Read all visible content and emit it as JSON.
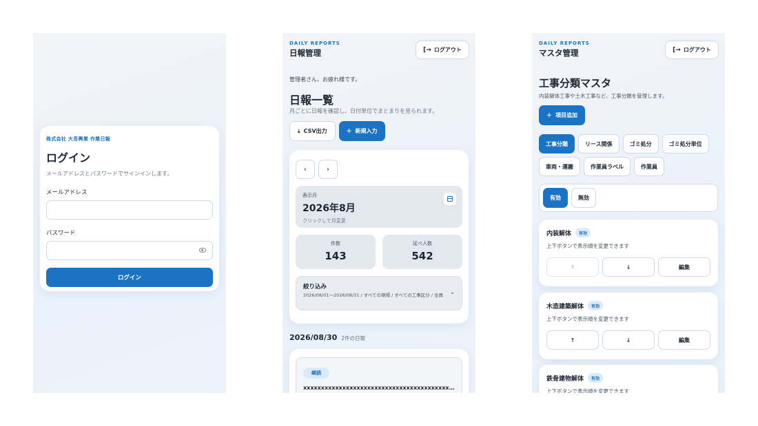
{
  "login": {
    "brand": "株式会社 大吾興業 作業日報",
    "title": "ログイン",
    "subtitle": "メールアドレスとパスワードでサインインします。",
    "email_label": "メールアドレス",
    "email_value": "",
    "password_label": "パスワード",
    "password_value": "",
    "submit_label": "ログイン"
  },
  "reports": {
    "kicker": "DAILY REPORTS",
    "title": "日報管理",
    "logout_label": "ログアウト",
    "greeting": "管理者さん、お疲れ様です。",
    "page_title": "日報一覧",
    "page_subtitle": "月ごとに日報を確認し、日付単位でまとまりを見られます。",
    "csv_label": "CSV出力",
    "new_label": "新規入力",
    "prev_label": "‹",
    "next_label": "›",
    "month_label": "表示月",
    "month_value": "2026年8月",
    "month_hint": "クリックして月変更",
    "stats": [
      {
        "label": "件数",
        "value": "143"
      },
      {
        "label": "延べ人数",
        "value": "542"
      }
    ],
    "filter_title": "絞り込み",
    "filter_desc": "2026/08/01〜2026/08/31 / すべての現場 / すべての工事区分 / 全員",
    "date_heading": "2026/08/30",
    "date_count": "2件の日報",
    "entry_status": "継続",
    "entry_text": "xxxxxxxxxxxxxxxxxxxxxxxxxxxxxxxxxxxxxxxxxxxxxxxx"
  },
  "master": {
    "kicker": "DAILY REPORTS",
    "title": "マスタ管理",
    "logout_label": "ログアウト",
    "page_title": "工事分類マスタ",
    "page_subtitle": "内装解体工事や土木工事など、工事分類を管理します。",
    "add_label": "項目追加",
    "tabs": [
      {
        "label": "工事分類",
        "active": true
      },
      {
        "label": "リース関係",
        "active": false
      },
      {
        "label": "ゴミ処分",
        "active": false
      },
      {
        "label": "ゴミ処分単位",
        "active": false
      },
      {
        "label": "車両・運搬",
        "active": false
      },
      {
        "label": "作業員ラベル",
        "active": false
      },
      {
        "label": "作業員",
        "active": false
      }
    ],
    "status_tabs": [
      {
        "label": "有効",
        "active": true
      },
      {
        "label": "無効",
        "active": false
      }
    ],
    "up_label": "↑",
    "down_label": "↓",
    "edit_label": "編集",
    "items": [
      {
        "name": "内装解体",
        "badge": "有効",
        "sub": "上下ボタンで表示順を変更できます"
      },
      {
        "name": "木造建築解体",
        "badge": "有効",
        "sub": "上下ボタンで表示順を変更できます"
      },
      {
        "name": "鉄骨建物解体",
        "badge": "有効",
        "sub": "上下ボタンで表示順を変更できます"
      }
    ]
  }
}
